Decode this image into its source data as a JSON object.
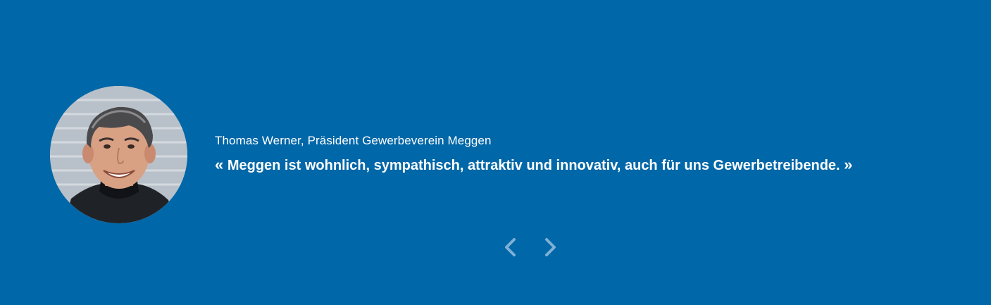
{
  "testimonial": {
    "author": "Thomas Werner, Präsident Gewerbeverein Meggen",
    "quote_open": "«",
    "quote_text": "Meggen ist wohnlich, sympathisch, attraktiv und innovativ, auch für uns Gewerbetreibende.",
    "quote_close": "»"
  },
  "navigation": {
    "prev_icon": "chevron-left-icon",
    "next_icon": "chevron-right-icon"
  },
  "colors": {
    "background": "#0067a8",
    "text": "#ffffff",
    "nav_arrow": "#7fb0d6"
  }
}
